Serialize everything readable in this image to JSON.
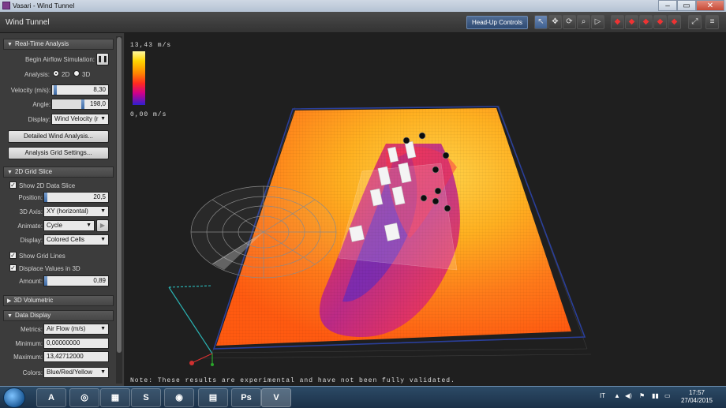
{
  "window": {
    "title": "Vasari - Wind Tunnel",
    "minimize": "–",
    "maximize": "▭",
    "close": "✕"
  },
  "appbar": {
    "name": "Wind Tunnel",
    "hud_label": "Head-Up Controls"
  },
  "toolbar": {
    "tools": [
      {
        "icon": "pointer-icon",
        "glyph": "↖"
      },
      {
        "icon": "move-icon",
        "glyph": "✥"
      },
      {
        "icon": "orbit-icon",
        "glyph": "⟳"
      },
      {
        "icon": "zoom-icon",
        "glyph": "⌕"
      },
      {
        "icon": "fly-icon",
        "glyph": "▷"
      }
    ],
    "views": [
      {
        "icon": "cube-view-icon",
        "glyph": "◆"
      },
      {
        "icon": "cube-top-icon",
        "glyph": "◆"
      },
      {
        "icon": "cube-front-icon",
        "glyph": "◆"
      },
      {
        "icon": "cube-right-icon",
        "glyph": "◆"
      },
      {
        "icon": "cube-left-icon",
        "glyph": "◆"
      }
    ],
    "fit_glyph": "⤢",
    "menu_glyph": "≡"
  },
  "realtime": {
    "title": "Real-Time Analysis",
    "begin_label": "Begin Airflow Simulation:",
    "pause_glyph": "❚❚",
    "analysis_label": "Analysis:",
    "opt_2d": "2D",
    "opt_3d": "3D",
    "selected": "2D",
    "velocity_label": "Velocity (m/s):",
    "velocity_value": "8,30",
    "velocity_fraction": 0.06,
    "angle_label": "Angle:",
    "angle_value": "198,0",
    "angle_fraction": 0.55,
    "display_label": "Display:",
    "display_value": "Wind Velocity (r",
    "detailed_button": "Detailed Wind Analysis...",
    "grid_button": "Analysis Grid Settings..."
  },
  "gridslice": {
    "title": "2D Grid Slice",
    "show_label": "Show 2D Data Slice",
    "position_label": "Position:",
    "position_value": "20,5",
    "position_fraction": 0.03,
    "axis_label": "3D Axis:",
    "axis_value": "XY (horizontal)",
    "animate_label": "Animate:",
    "animate_value": "Cycle",
    "play_glyph": "▶",
    "display_label": "Display:",
    "display_value": "Colored Cells",
    "gridlines_label": "Show Grid Lines",
    "displace_label": "Displace Values in 3D",
    "amount_label": "Amount:",
    "amount_value": "0,89",
    "amount_fraction": 0.02
  },
  "volumetric": {
    "title": "3D Volumetric"
  },
  "datadisplay": {
    "title": "Data Display",
    "metrics_label": "Metrics:",
    "metrics_value": "Air Flow (m/s)",
    "minimum_label": "Minimum:",
    "minimum_value": "0,00000000",
    "maximum_label": "Maximum:",
    "maximum_value": "13,42712000",
    "colors_label": "Colors:",
    "colors_value": "Blue/Red/Yellow"
  },
  "viewport": {
    "legend_max": "13,43 m/s",
    "legend_min": "0,00 m/s",
    "note": "Note: These results are experimental and have not been fully validated."
  },
  "taskbar": {
    "apps": [
      {
        "icon": "autocad-icon",
        "glyph": "A",
        "color": "#d32f2f"
      },
      {
        "icon": "globe-icon",
        "glyph": "◎",
        "color": "#3a8fd6"
      },
      {
        "icon": "office-icon",
        "glyph": "▦",
        "color": "#e8731c"
      },
      {
        "icon": "skype-icon",
        "glyph": "S",
        "color": "#18a9e6"
      },
      {
        "icon": "firefox-icon",
        "glyph": "◉",
        "color": "#f07e1a"
      },
      {
        "icon": "folder-icon",
        "glyph": "▤",
        "color": "#e0c068"
      },
      {
        "icon": "photoshop-icon",
        "glyph": "Ps",
        "color": "#1b3b66"
      },
      {
        "icon": "vasari-icon",
        "glyph": "V",
        "color": "#7c3b8a"
      }
    ],
    "lang": "IT",
    "time": "17:57",
    "date": "27/04/2015"
  }
}
